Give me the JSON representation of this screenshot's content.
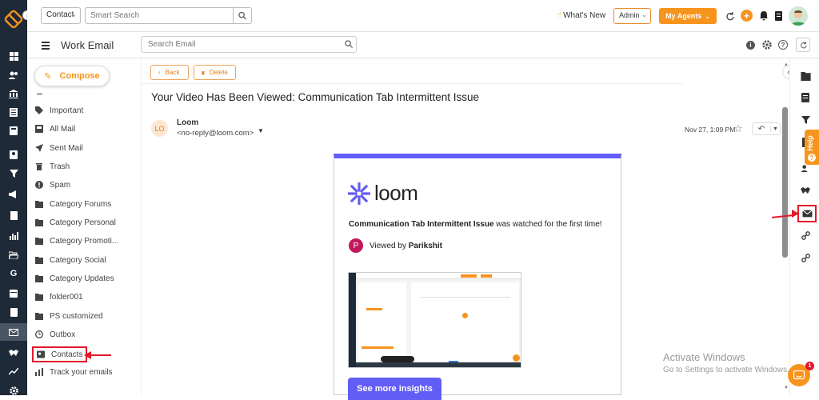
{
  "topbar": {
    "contact_select": "Contact",
    "search_placeholder": "Smart Search",
    "whats_new": "What's New",
    "admin_select": "Admin",
    "my_agents": "My Agents"
  },
  "subbar": {
    "title": "Work Email",
    "search_placeholder": "Search Email"
  },
  "sidebar": {
    "compose_label": "Compose",
    "items": [
      {
        "label": "Important",
        "icon": "tag-icon"
      },
      {
        "label": "All Mail",
        "icon": "inbox-icon"
      },
      {
        "label": "Sent Mail",
        "icon": "send-icon"
      },
      {
        "label": "Trash",
        "icon": "trash-icon"
      },
      {
        "label": "Spam",
        "icon": "alert-icon"
      },
      {
        "label": "Category Forums",
        "icon": "folder-icon"
      },
      {
        "label": "Category Personal",
        "icon": "folder-icon"
      },
      {
        "label": "Category Promoti...",
        "icon": "folder-icon"
      },
      {
        "label": "Category Social",
        "icon": "folder-icon"
      },
      {
        "label": "Category Updates",
        "icon": "folder-icon"
      },
      {
        "label": "folder001",
        "icon": "folder-icon"
      },
      {
        "label": "PS customized",
        "icon": "folder-icon"
      },
      {
        "label": "Outbox",
        "icon": "clock-icon"
      },
      {
        "label": "Contacts",
        "icon": "contacts-icon"
      },
      {
        "label": "Track your emails",
        "icon": "chart-icon"
      }
    ]
  },
  "mail": {
    "back_label": "Back",
    "delete_label": "Delete",
    "subject": "Your Video Has Been Viewed: Communication Tab Intermittent Issue",
    "avatar": "LO",
    "sender_name": "Loom",
    "sender_email": "<no-reply@loom.com>",
    "date": "Nov 27, 1:09 PM",
    "body": {
      "brand": "loom",
      "video_title": "Communication Tab Intermittent Issue",
      "watched_text": " was watched for the first time!",
      "viewer_avatar": "P",
      "viewed_by": "Viewed by ",
      "viewer_name": "Parikshit",
      "insights_button": "See more insights"
    }
  },
  "rightrail": {
    "help_label": "Help",
    "expand_icon": "«"
  },
  "watermark": {
    "line1": "Activate Windows",
    "line2": "Go to Settings to activate Windows."
  },
  "chat_badge": "1",
  "colors": {
    "accent": "#f7941d",
    "rail": "#1f2a38",
    "loom_purple": "#625df5",
    "highlight_red": "#e0192a"
  }
}
